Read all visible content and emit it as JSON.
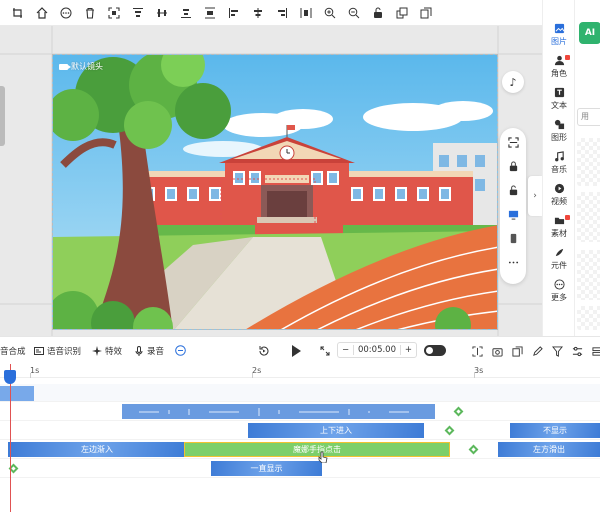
{
  "toolbar": {
    "buttons": [
      "crop-icon",
      "home-icon",
      "more-icon",
      "delete-icon",
      "fit-icon",
      "align-top-icon",
      "align-middle-icon",
      "align-bottom-icon",
      "distribute-icon",
      "align-left-icon",
      "align-center-icon",
      "align-right-icon",
      "distribute-h-icon",
      "zoom-in-icon",
      "zoom-out-icon",
      "unlock-icon",
      "layer-up-icon",
      "copy-icon"
    ]
  },
  "canvas": {
    "camera_label": "默认镜头"
  },
  "side_nav": {
    "items": [
      {
        "label": "图片",
        "icon": "image-icon",
        "active": true
      },
      {
        "label": "角色",
        "icon": "character-icon",
        "badge": true
      },
      {
        "label": "文本",
        "icon": "text-icon"
      },
      {
        "label": "图形",
        "icon": "shape-icon"
      },
      {
        "label": "音乐",
        "icon": "music-icon"
      },
      {
        "label": "视频",
        "icon": "video-icon"
      },
      {
        "label": "素材",
        "icon": "material-icon",
        "badge": true
      },
      {
        "label": "元件",
        "icon": "component-icon"
      },
      {
        "label": "更多",
        "icon": "more-icon"
      }
    ]
  },
  "side_content": {
    "logo": "AI",
    "search_placeholder": "用"
  },
  "controls": {
    "items": [
      "音合成",
      "语音识别",
      "特效",
      "录音"
    ],
    "time": "00:05.00",
    "minus": "−",
    "plus": "+"
  },
  "timeline": {
    "ruler": [
      "1s",
      "2s",
      "3s"
    ],
    "clips": {
      "up_in": "上下进入",
      "hide": "不显示",
      "left_in": "左边渐入",
      "rotate": "魔娜手指点击",
      "right_out": "左方滑出",
      "always": "一直显示"
    }
  }
}
